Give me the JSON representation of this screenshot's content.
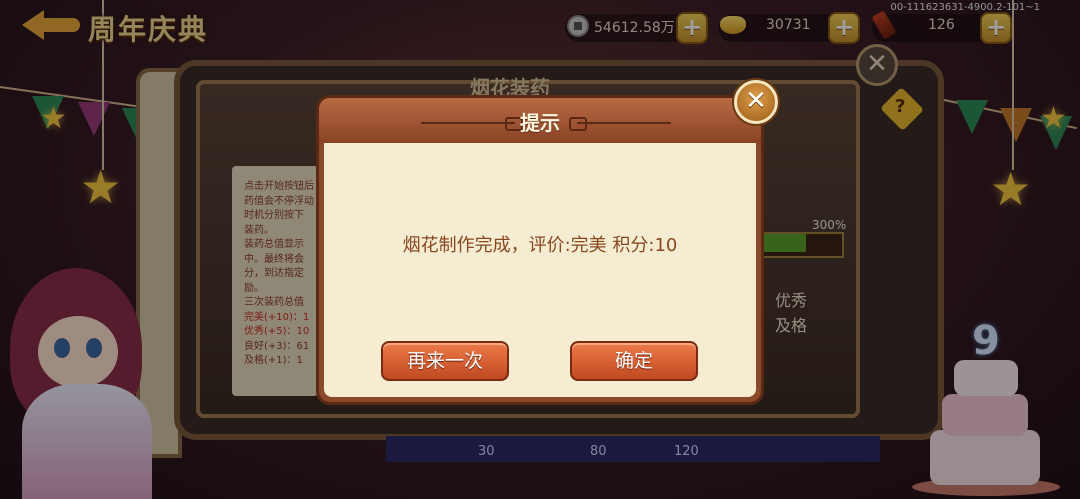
{
  "header": {
    "back_icon": "arrow-left-icon",
    "title": "周年庆典",
    "build_id": "00-111623631-4900.2-101~1"
  },
  "resources": [
    {
      "name": "copper-coin",
      "icon": "coin-icon",
      "value": "54612.58万",
      "add_icon": "plus-icon"
    },
    {
      "name": "gold-ingot",
      "icon": "ingot-icon",
      "value": "30731",
      "add_icon": "plus-icon"
    },
    {
      "name": "firework-item",
      "icon": "torch-icon",
      "value": "126",
      "add_icon": "plus-icon"
    }
  ],
  "panel": {
    "title": "烟花装药",
    "close_glyph": "✕",
    "help_glyph": "?",
    "rules": [
      "点击开始按钮后",
      "药值会不停浮动",
      "时机分别按下",
      "装药。",
      "装药总值显示",
      "中。最终将会",
      "分，到达指定",
      "励。",
      "三次装药总值",
      "完美(+10)：1",
      "优秀(+5)：10",
      "良好(+3)：61",
      "及格(+1)：1"
    ],
    "meter_percent": "300%",
    "meter_fill": 0.58,
    "grades": [
      "优秀",
      "及格"
    ],
    "scale_labels": [
      "30",
      "80",
      "120"
    ]
  },
  "dialog": {
    "title": "提示",
    "message": "烟花制作完成，评价:完美 积分:10",
    "retry_label": "再来一次",
    "confirm_label": "确定",
    "close_glyph": "✕"
  },
  "decor": {
    "cake_number": "9",
    "accent_color": "#e9a83a",
    "dialog_header_color": "#b86a44",
    "button_color": "#e06a3a"
  }
}
